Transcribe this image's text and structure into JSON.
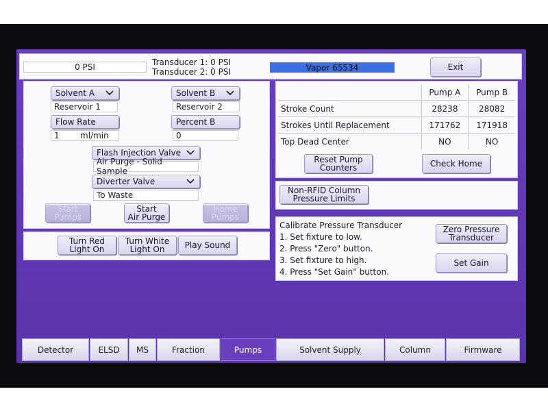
{
  "header": {
    "psi_readout": "0 PSI",
    "transducer1": "Transducer 1: 0 PSI",
    "transducer2": "Transducer 2: 0 PSI",
    "device_name": "Vapor 65534",
    "exit_label": "Exit"
  },
  "pump_setup": {
    "solvent_a_label": "Solvent A",
    "solvent_a_value": "Reservoir 1",
    "solvent_b_label": "Solvent B",
    "solvent_b_value": "Reservoir 2",
    "flow_rate_label": "Flow Rate",
    "flow_rate_value": "1",
    "flow_rate_unit": "ml/min",
    "percent_b_label": "Percent B",
    "percent_b_value": "0",
    "flash_valve_label": "Flash Injection Valve",
    "flash_valve_value": "Air Purge - Solid Sample",
    "diverter_label": "Diverter Valve",
    "diverter_value": "To Waste",
    "start_pumps": [
      "Start",
      "Pumps"
    ],
    "start_air_purge": [
      "Start",
      "Air Purge"
    ],
    "home_pumps": [
      "Home",
      "Pumps"
    ]
  },
  "lights": {
    "red": [
      "Turn Red",
      "Light On"
    ],
    "white": [
      "Turn White",
      "Light On"
    ],
    "sound": "Play Sound"
  },
  "counters": {
    "headers": [
      "Pump A",
      "Pump B"
    ],
    "rows": [
      {
        "label": "Stroke Count",
        "a": "28238",
        "b": "28082"
      },
      {
        "label": "Strokes Until Replacement",
        "a": "171762",
        "b": "171918"
      },
      {
        "label": "Top Dead Center",
        "a": "NO",
        "b": "NO"
      }
    ],
    "reset": [
      "Reset Pump",
      "Counters"
    ],
    "check_home": "Check Home"
  },
  "non_rfid": [
    "Non-RFID Column",
    "Pressure Limits"
  ],
  "calibrate": {
    "title": "Calibrate Pressure Transducer",
    "steps": [
      "1. Set fixture to low.",
      "2. Press \"Zero\" button.",
      "3. Set fixture to high.",
      "4. Press \"Set Gain\" button."
    ],
    "zero": [
      "Zero Pressure",
      "Transducer"
    ],
    "set_gain": "Set Gain"
  },
  "tabs": [
    "Detector",
    "ELSD",
    "MS",
    "Fraction",
    "Pumps",
    "Solvent Supply",
    "Column",
    "Firmware"
  ],
  "active_tab": "Pumps",
  "colors": {
    "screen": "#6a3fbf",
    "device_bar": "#3c6fe0"
  }
}
